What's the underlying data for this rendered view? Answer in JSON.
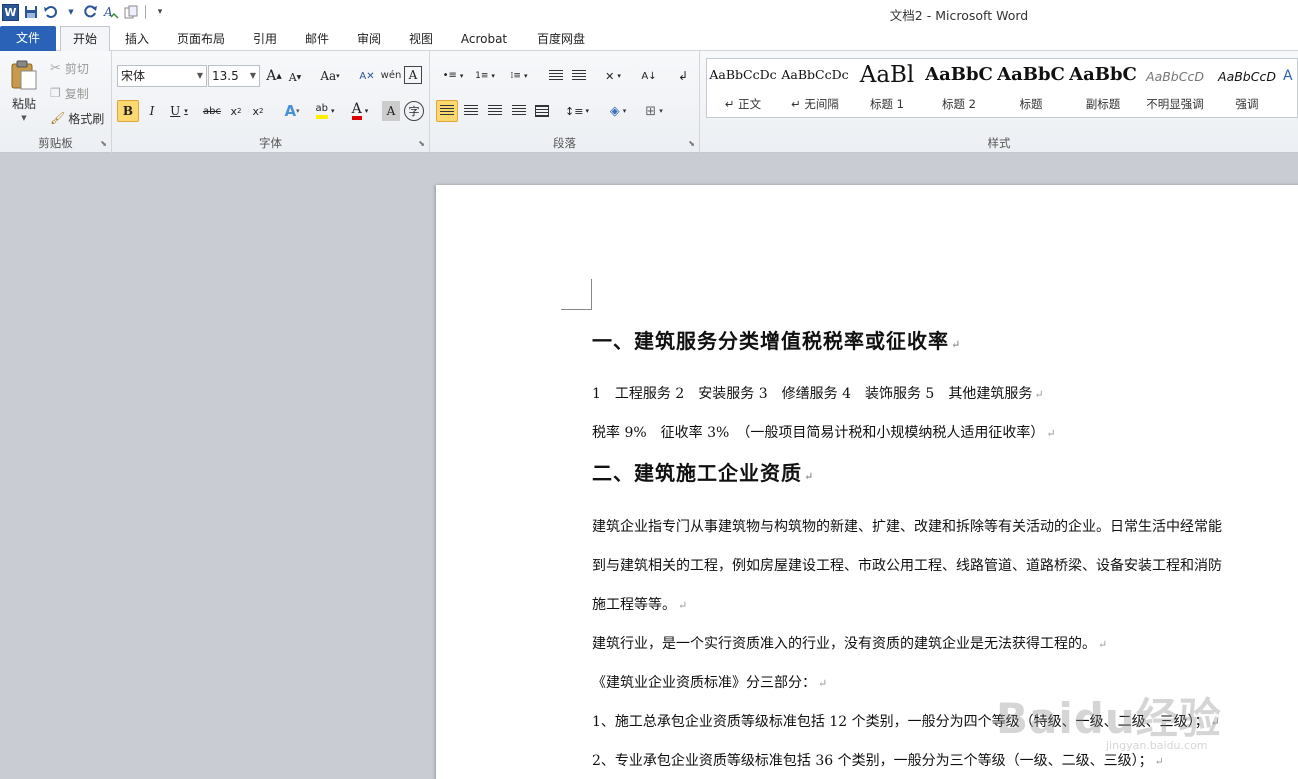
{
  "window": {
    "title": "文档2 - Microsoft Word"
  },
  "qat": {
    "app_icon_letter": "W",
    "save_icon": "save-icon",
    "undo_icon": "undo-icon",
    "redo_icon": "redo-icon"
  },
  "tabs": [
    {
      "label": "文件"
    },
    {
      "label": "开始"
    },
    {
      "label": "插入"
    },
    {
      "label": "页面布局"
    },
    {
      "label": "引用"
    },
    {
      "label": "邮件"
    },
    {
      "label": "审阅"
    },
    {
      "label": "视图"
    },
    {
      "label": "Acrobat"
    },
    {
      "label": "百度网盘"
    }
  ],
  "ribbon": {
    "clipboard": {
      "label": "剪贴板",
      "paste": "粘贴",
      "cut": "剪切",
      "copy": "复制",
      "format_painter": "格式刷"
    },
    "font": {
      "label": "字体",
      "font_name": "宋体",
      "font_size": "13.5"
    },
    "paragraph": {
      "label": "段落"
    },
    "styles": {
      "label": "样式",
      "items": [
        {
          "sample": "AaBbCcDc",
          "name": "↵ 正文"
        },
        {
          "sample": "AaBbCcDc",
          "name": "↵ 无间隔"
        },
        {
          "sample": "AaBl",
          "name": "标题 1"
        },
        {
          "sample": "AaBbC",
          "name": "标题 2"
        },
        {
          "sample": "AaBbC",
          "name": "标题"
        },
        {
          "sample": "AaBbC",
          "name": "副标题"
        },
        {
          "sample": "AaBbCcD",
          "name": "不明显强调"
        },
        {
          "sample": "AaBbCcD",
          "name": "强调"
        }
      ]
    }
  },
  "document": {
    "paragraphs": [
      "一、建筑服务分类增值税税率或征收率",
      "1　工程服务 2　安装服务 3　修缮服务 4　装饰服务 5　其他建筑服务",
      "税率 9%　征收率 3%　（一般项目简易计税和小规模纳税人适用征收率）",
      "二、建筑施工企业资质",
      "建筑企业指专门从事建筑物与构筑物的新建、扩建、改建和拆除等有关活动的企业。日常生活中经常能",
      "到与建筑相关的工程，例如房屋建设工程、市政公用工程、线路管道、道路桥梁、设备安装工程和消防",
      "施工程等等。",
      "建筑行业，是一个实行资质准入的行业，没有资质的建筑企业是无法获得工程的。",
      "《建筑业企业资质标准》分三部分：",
      "1、施工总承包企业资质等级标准包括 12 个类别，一般分为四个等级（特级、一级、二级、三级）；",
      "2、专业承包企业资质等级标准包括 36 个类别，一般分为三个等级（一级、二级、三级）；"
    ]
  },
  "watermark": {
    "text": "Baidu经验",
    "url": "jingyan.baidu.com"
  }
}
